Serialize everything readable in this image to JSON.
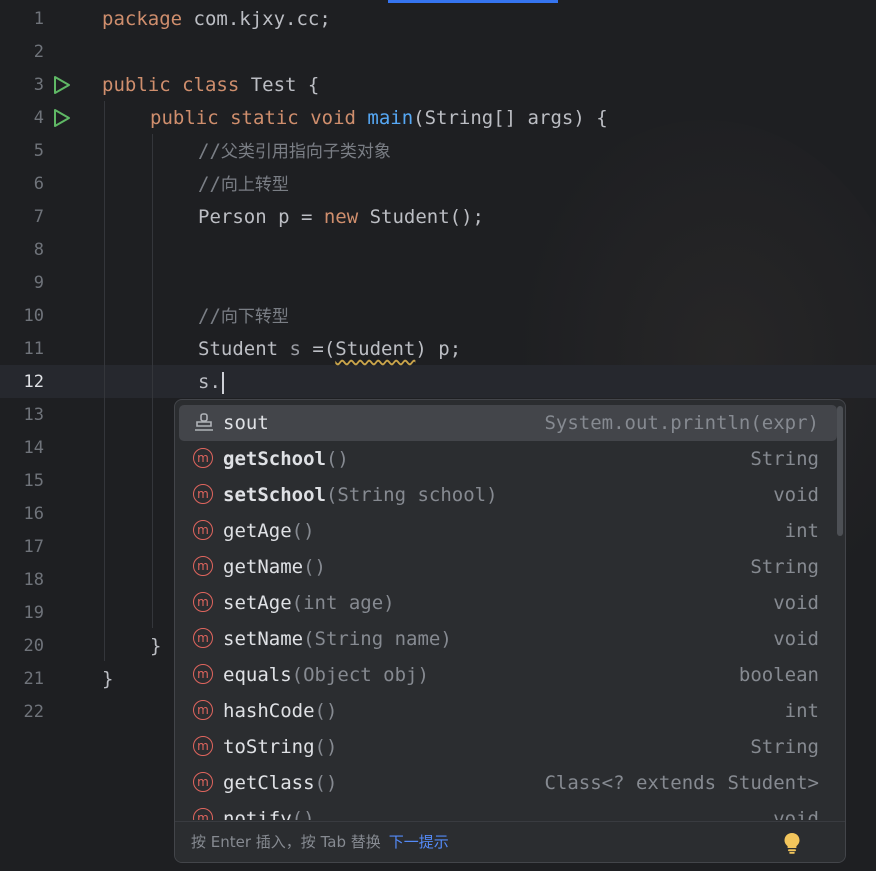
{
  "gutter": {
    "line_numbers": [
      "1",
      "2",
      "3",
      "4",
      "5",
      "6",
      "7",
      "8",
      "9",
      "10",
      "11",
      "12",
      "13",
      "14",
      "15",
      "16",
      "17",
      "18",
      "19",
      "20",
      "21",
      "22"
    ],
    "current_line": "12"
  },
  "code": {
    "l1": {
      "kw": "package",
      "rest": " com.kjxy.cc;"
    },
    "l3": {
      "kw1": "public",
      "kw2": "class",
      "rest": " Test {"
    },
    "l4": {
      "kw1": "public",
      "kw2": "static",
      "kw3": "void",
      "fn": "main",
      "rest": "(String[] args) {"
    },
    "l5": {
      "slashes": "//",
      "text": "父类引用指向子类对象"
    },
    "l6": {
      "slashes": "//",
      "text": "向上转型"
    },
    "l7": {
      "a": "Person p = ",
      "kw": "new",
      "b": " Student();"
    },
    "l10": {
      "slashes": "//",
      "text": "向下转型"
    },
    "l11": {
      "a": "Student ",
      "var": "s",
      "b": " =(",
      "cast": "Student",
      "c": ") p;"
    },
    "l12": {
      "text": "s."
    },
    "l20": {
      "text": "}"
    },
    "l21": {
      "text": "}"
    }
  },
  "completion": {
    "items": [
      {
        "icon": "live-template",
        "name": "sout",
        "params": "",
        "type": "System.out.println(expr)",
        "bold": false
      },
      {
        "icon": "method",
        "name": "getSchool",
        "params": "()",
        "type": "String",
        "bold": true
      },
      {
        "icon": "method",
        "name": "setSchool",
        "params": "(String school)",
        "type": "void",
        "bold": true
      },
      {
        "icon": "method",
        "name": "getAge",
        "params": "()",
        "type": "int",
        "bold": false
      },
      {
        "icon": "method",
        "name": "getName",
        "params": "()",
        "type": "String",
        "bold": false
      },
      {
        "icon": "method",
        "name": "setAge",
        "params": "(int age)",
        "type": "void",
        "bold": false
      },
      {
        "icon": "method",
        "name": "setName",
        "params": "(String name)",
        "type": "void",
        "bold": false
      },
      {
        "icon": "method",
        "name": "equals",
        "params": "(Object obj)",
        "type": "boolean",
        "bold": false
      },
      {
        "icon": "method",
        "name": "hashCode",
        "params": "()",
        "type": "int",
        "bold": false
      },
      {
        "icon": "method",
        "name": "toString",
        "params": "()",
        "type": "String",
        "bold": false
      },
      {
        "icon": "method",
        "name": "getClass",
        "params": "()",
        "type": "Class<? extends Student>",
        "bold": false
      },
      {
        "icon": "method",
        "name": "notify",
        "params": "()",
        "type": "void",
        "bold": false
      }
    ],
    "selected_index": 0,
    "method_icon_glyph": "m",
    "footer_hint": "按 Enter 插入，按 Tab 替换",
    "footer_next": "下一提示",
    "bulb_icon": "lightbulb-icon"
  },
  "colors": {
    "accent": "#3574f0",
    "keyword": "#cf8e6d",
    "function": "#56a8f5",
    "comment": "#7a7e85",
    "method_icon": "#e0655e",
    "run_icon": "#5fb865",
    "link": "#548af7"
  }
}
